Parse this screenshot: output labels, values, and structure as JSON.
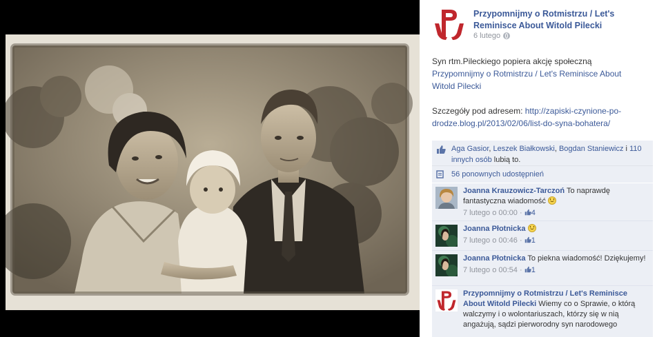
{
  "post": {
    "page_name": "Przypomnijmy o Rotmistrzu / Let's Reminisce About Witold Pilecki",
    "date": "6 lutego",
    "line1": "Syn rtm.Pileckiego popiera akcję społeczną",
    "link_page": "Przypomnijmy o Rotmistrzu / Let's Reminisce About Witold Pilecki",
    "details_prefix": "Szczegóły pod adresem:",
    "details_url": "http://zapiski-czynione-po-drodze.blog.pl/2013/02/06/list-do-syna-bohatera/"
  },
  "likes": {
    "name1": "Aga Gasior",
    "sep1": ", ",
    "name2": "Leszek Białkowski",
    "sep2": ", ",
    "name3": "Bogdan Staniewicz",
    "and": " i ",
    "others": "110 innych osób",
    "suffix": " lubią to."
  },
  "shares": {
    "label": "56 ponownych udostępnień"
  },
  "comments": [
    {
      "author": "Joanna Krauzowicz-Tarczoń",
      "text": " To naprawdę fantastyczna wiadomość ",
      "time": "7 lutego o 00:00",
      "sep": " · ",
      "likes": "4"
    },
    {
      "author": "Joanna Płotnicka",
      "text": " ",
      "time": "7 lutego o 00:46",
      "sep": " · ",
      "likes": "1"
    },
    {
      "author": "Joanna Płotnicka",
      "text": " To piekna wiadomość! Dziękujemy!",
      "time": "7 lutego o 00:54",
      "sep": " · ",
      "likes": "1"
    },
    {
      "author": "Przypomnijmy o Rotmistrzu / Let's Reminisce About Witold Pilecki",
      "text": " Wiemy co o Sprawie, o którą walczymy i o wolontariuszach, którzy się w nią angażują, sądzi pierworodny syn narodowego"
    }
  ],
  "colors": {
    "link": "#3b5998",
    "comment_bg": "#eceff5",
    "logo_red": "#c0272d",
    "viewer_bg": "#000000"
  },
  "icons": {
    "page_logo": "polska-walczaca-anchor-icon",
    "privacy": "globe-icon",
    "like": "thumbs-up-icon",
    "share": "share-icon",
    "emoticon": "smile-icon"
  }
}
